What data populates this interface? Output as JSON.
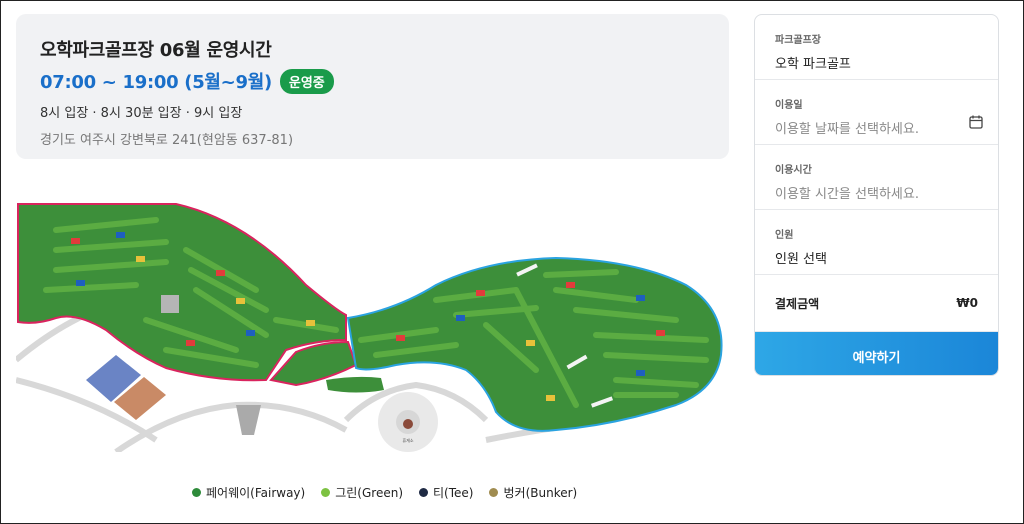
{
  "info": {
    "title": "오학파크골프장 06월 운영시간",
    "hours": "07:00 ~ 19:00 (5월~9월)",
    "status_badge": "운영중",
    "entry_times": "8시 입장 · 8시 30분 입장 · 9시 입장",
    "address": "경기도 여주시 강변북로 241(현암동 637-81)"
  },
  "map": {
    "building_label": "휴게소"
  },
  "legend": [
    {
      "label": "페어웨이(Fairway)",
      "color": "#2e8b3a"
    },
    {
      "label": "그린(Green)",
      "color": "#7dc242"
    },
    {
      "label": "티(Tee)",
      "color": "#1f2a44"
    },
    {
      "label": "벙커(Bunker)",
      "color": "#a08c50"
    }
  ],
  "booking": {
    "course": {
      "label": "파크골프장",
      "value": "오학 파크골프"
    },
    "date": {
      "label": "이용일",
      "placeholder": "이용할 날짜를 선택하세요."
    },
    "time": {
      "label": "이용시간",
      "placeholder": "이용할 시간을 선택하세요."
    },
    "people": {
      "label": "인원",
      "value": "인원 선택"
    },
    "payment": {
      "label": "결제금액",
      "value": "₩0"
    },
    "reserve_label": "예약하기"
  },
  "colors": {
    "accent_blue": "#1a6fc9",
    "badge_green": "#1a9b4a",
    "button_blue": "#1b86d8"
  }
}
